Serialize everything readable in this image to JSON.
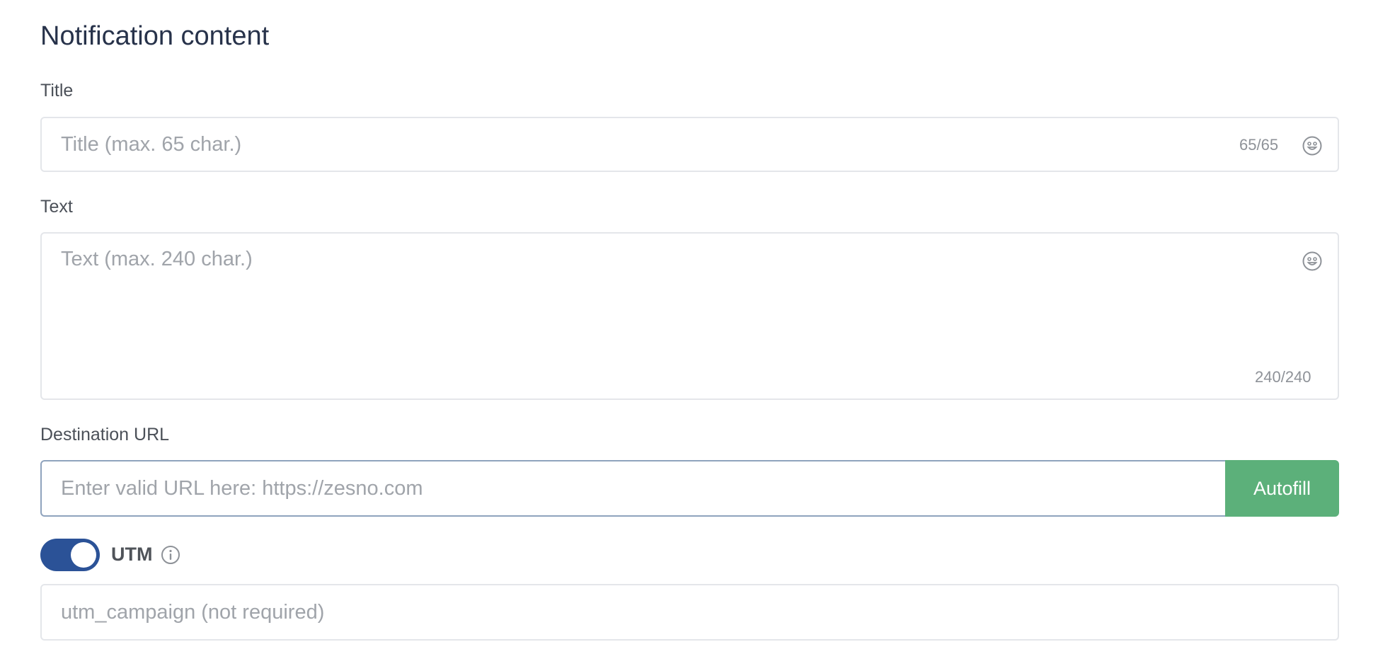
{
  "section": {
    "title": "Notification content"
  },
  "title_field": {
    "label": "Title",
    "placeholder": "Title (max. 65 char.)",
    "counter": "65/65"
  },
  "text_field": {
    "label": "Text",
    "placeholder": "Text (max. 240 char.)",
    "counter": "240/240"
  },
  "url_field": {
    "label": "Destination URL",
    "placeholder": "Enter valid URL here: https://zesno.com",
    "button_label": "Autofill"
  },
  "utm": {
    "label": "UTM",
    "toggle_on": true,
    "placeholder": "utm_campaign (not required)"
  },
  "icons": {
    "emoji": "smiley-face-icon",
    "info": "info-circle-icon"
  },
  "colors": {
    "accent": "#2b5297",
    "button": "#5cb07a",
    "heading": "#27324a",
    "placeholder": "#a0a4aa"
  }
}
